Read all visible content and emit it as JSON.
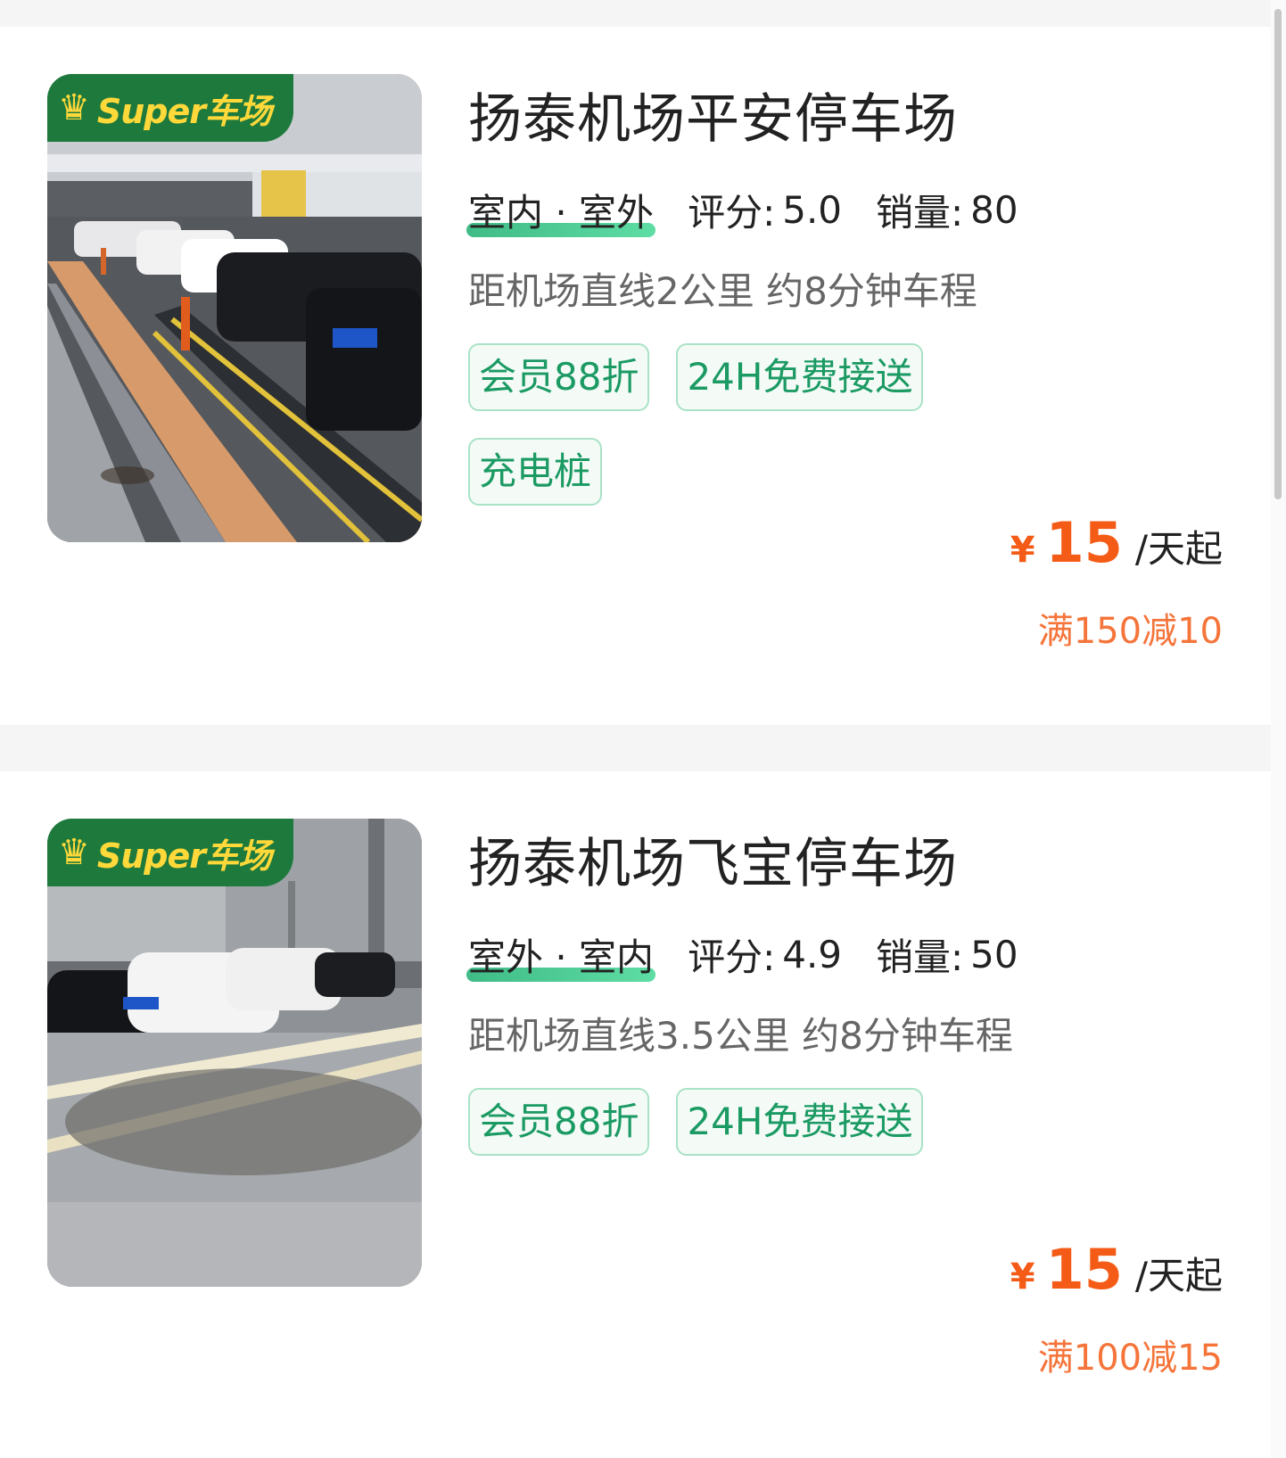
{
  "lots": [
    {
      "badge": "Super车场",
      "name": "扬泰机场平安停车场",
      "type": "室内 · 室外",
      "rating_label": "评分:",
      "rating": "5.0",
      "sales_label": "销量:",
      "sales": "80",
      "distance": "距机场直线2公里 约8分钟车程",
      "tags": [
        "会员88折",
        "24H免费接送",
        "充电桩"
      ],
      "currency": "¥",
      "price": "15",
      "price_unit": "/天起",
      "promo": "满150减10"
    },
    {
      "badge": "Super车场",
      "name": "扬泰机场飞宝停车场",
      "type": "室外 · 室内",
      "rating_label": "评分:",
      "rating": "4.9",
      "sales_label": "销量:",
      "sales": "50",
      "distance": "距机场直线3.5公里 约8分钟车程",
      "tags": [
        "会员88折",
        "24H免费接送"
      ],
      "currency": "¥",
      "price": "15",
      "price_unit": "/天起",
      "promo": "满100减15"
    }
  ],
  "colors": {
    "badge_bg": "#1d7a3c",
    "badge_text": "#ffd83a",
    "tag_text": "#1b9a63",
    "tag_border": "#a9e2c6",
    "price": "#f45b16",
    "promo": "#f5743a"
  },
  "icons": {
    "badge": "crown-icon"
  }
}
